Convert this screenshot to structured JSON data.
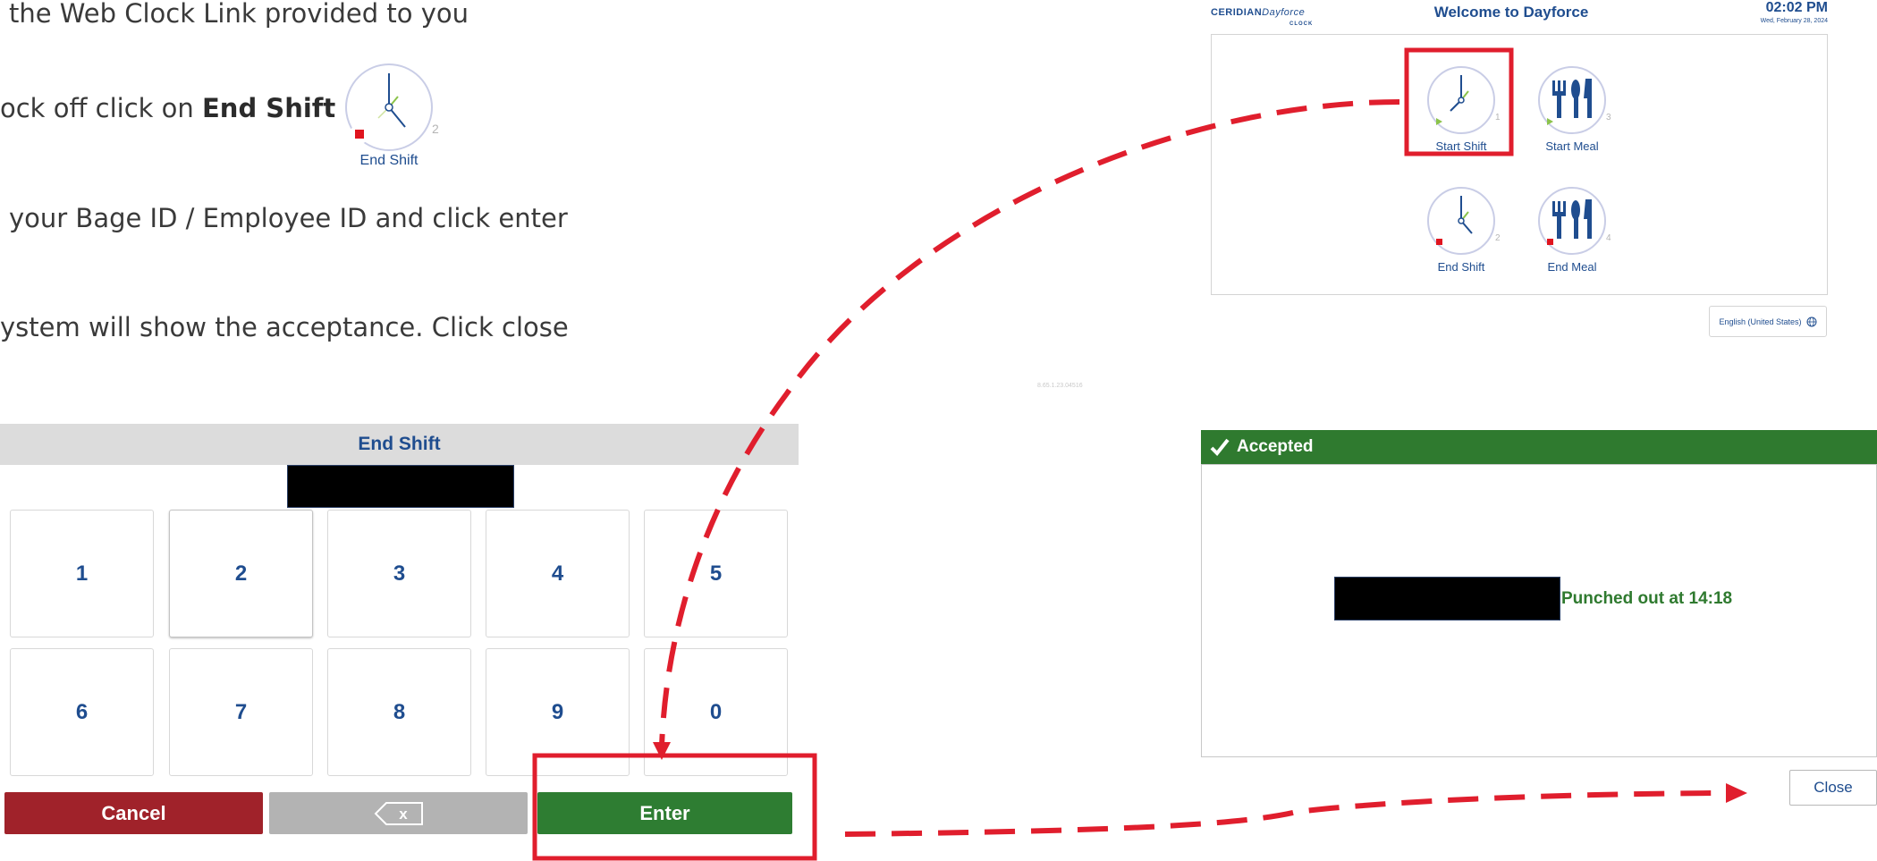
{
  "instructions": {
    "line1": "the Web Clock Link provided to you",
    "line2_prefix": "ock off click  on ",
    "line2_bold": "End Shift",
    "line3": "your Bage ID / Employee ID and click enter",
    "line4": "ystem will show the acceptance. Click close"
  },
  "mini_clock": {
    "label": "End Shift",
    "number": "2"
  },
  "keypad": {
    "header": "End Shift",
    "keys": [
      "1",
      "2",
      "3",
      "4",
      "5",
      "6",
      "7",
      "8",
      "9",
      "0"
    ],
    "selected_key": "2",
    "cancel_label": "Cancel",
    "backspace_symbol": "x",
    "enter_label": "Enter"
  },
  "dayforce": {
    "logo_brand": "CERIDIAN",
    "logo_product": "Dayforce",
    "logo_sub": "CLOCK",
    "title": "Welcome to Dayforce",
    "time": "02:02 PM",
    "date": "Wed, February 28, 2024",
    "tiles": [
      {
        "label": "Start Shift",
        "number": "1",
        "icon": "clock-icon",
        "badge": "play"
      },
      {
        "label": "Start Meal",
        "number": "3",
        "icon": "fork-knife-icon",
        "badge": "play"
      },
      {
        "label": "End Shift",
        "number": "2",
        "icon": "clock-icon",
        "badge": "stop"
      },
      {
        "label": "End Meal",
        "number": "4",
        "icon": "fork-knife-icon",
        "badge": "stop"
      }
    ],
    "language": "English (United States)",
    "version": "8.65.1.23.04516"
  },
  "accepted": {
    "title": "Accepted",
    "message": "Punched out at 14:18",
    "close_label": "Close"
  },
  "colors": {
    "brand_blue": "#1f4d8f",
    "cancel_red": "#a0222a",
    "enter_green": "#2e7d32",
    "accepted_green": "#2f7a2f",
    "annotation_red": "#e01e2d"
  }
}
